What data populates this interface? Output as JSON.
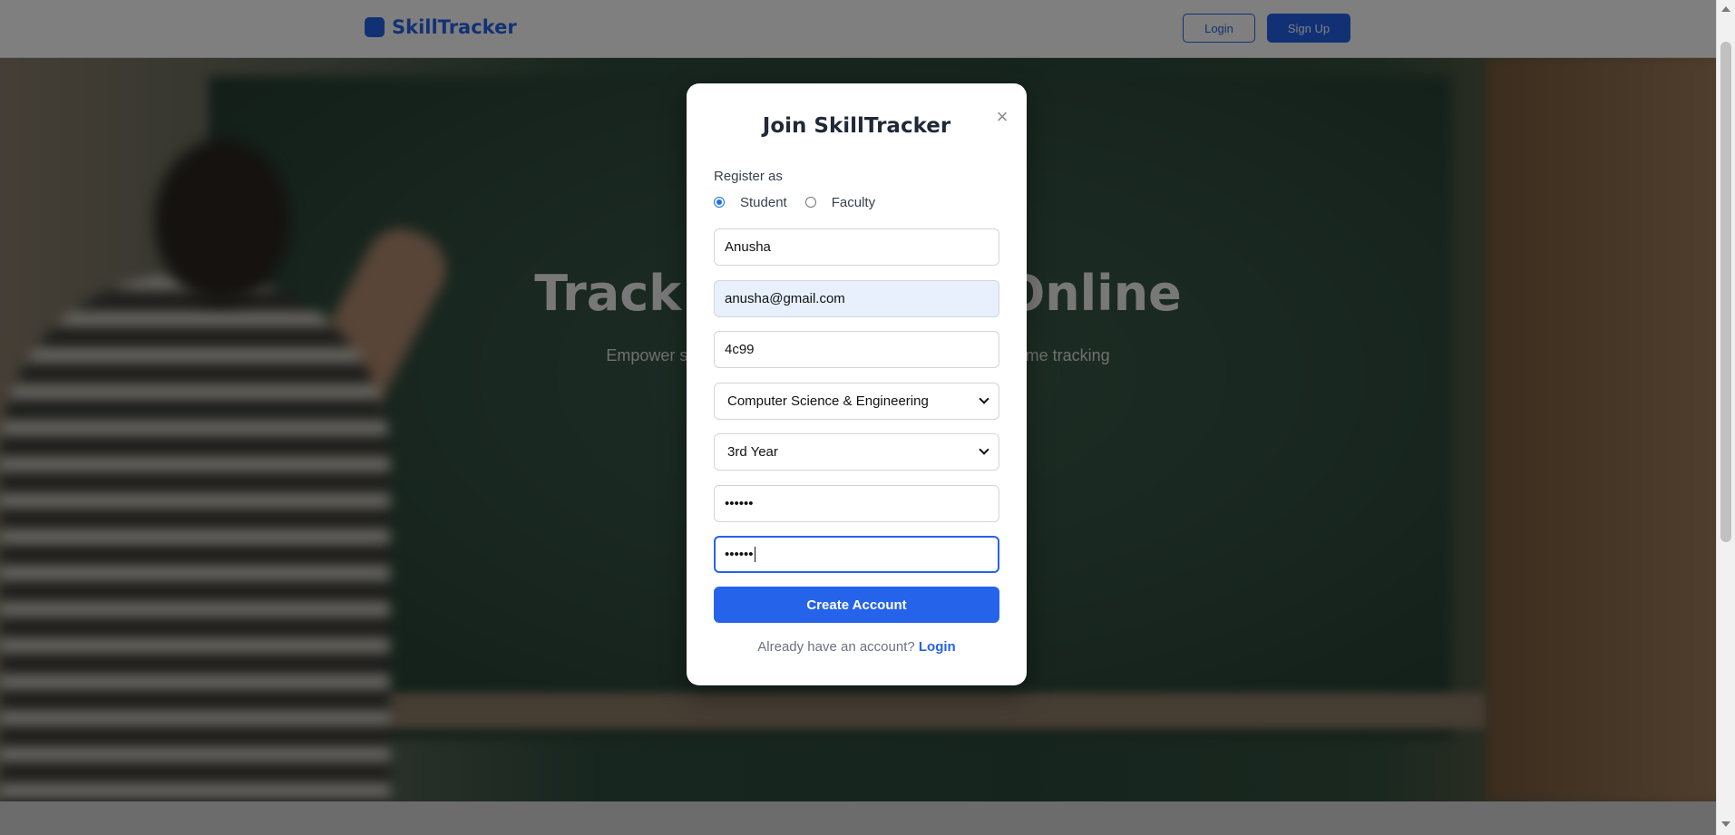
{
  "nav": {
    "brand": "SkillTracker",
    "login_label": "Login",
    "signup_label": "Sign Up"
  },
  "hero": {
    "title": "Track Your Skills Online",
    "subtitle": "Empower students and faculty to manage skills with real-time tracking"
  },
  "modal": {
    "title": "Join SkillTracker",
    "close_symbol": "×",
    "role_label": "Register as",
    "roles": [
      {
        "label": "Student",
        "selected": true
      },
      {
        "label": "Faculty",
        "selected": false
      }
    ],
    "fields": {
      "name": "Anusha",
      "email": "anusha@gmail.com",
      "id": "4c99",
      "department": "Computer Science & Engineering",
      "year": "3rd Year",
      "password": "••••••",
      "confirm_password": "••••••"
    },
    "submit_label": "Create Account",
    "footer_text": "Already have an account?",
    "footer_link": "Login"
  },
  "colors": {
    "accent": "#2563eb",
    "autofill": "#e8f0fe"
  }
}
